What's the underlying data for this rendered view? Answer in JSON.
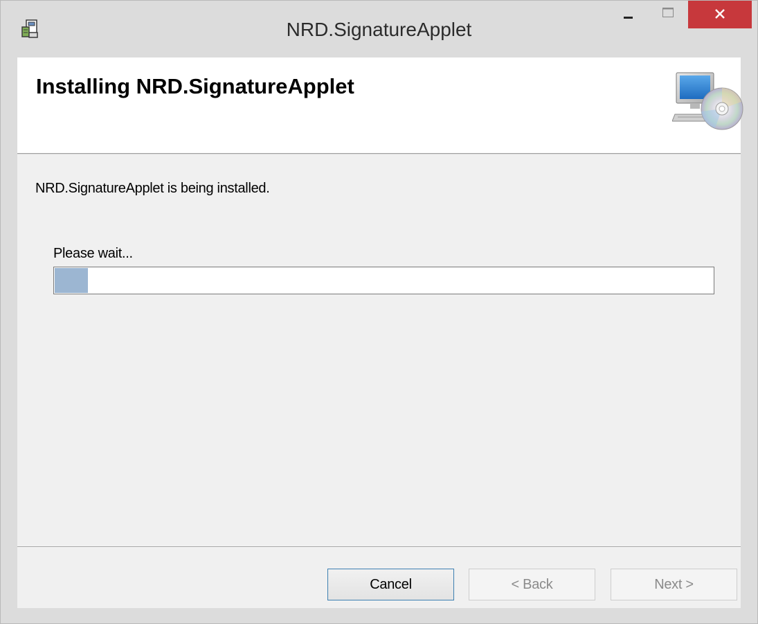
{
  "window": {
    "title": "NRD.SignatureApplet",
    "app_icon": "installer-icon",
    "controls": {
      "minimize_icon": "minimize-icon",
      "maximize_icon": "maximize-icon",
      "close_icon": "close-icon"
    },
    "colors": {
      "close_button": "#c7383c",
      "frame": "#dcdcdc",
      "progress_fill": "#9cb6d2",
      "focus_border": "#3c7fb1"
    }
  },
  "header": {
    "title": "Installing NRD.SignatureApplet",
    "icon": "computer-cd-icon"
  },
  "body": {
    "status": "NRD.SignatureApplet is being installed.",
    "wait_label": "Please wait...",
    "progress_fraction": 0.05
  },
  "footer": {
    "cancel_label": "Cancel",
    "back_label": "< Back",
    "next_label": "Next >"
  }
}
